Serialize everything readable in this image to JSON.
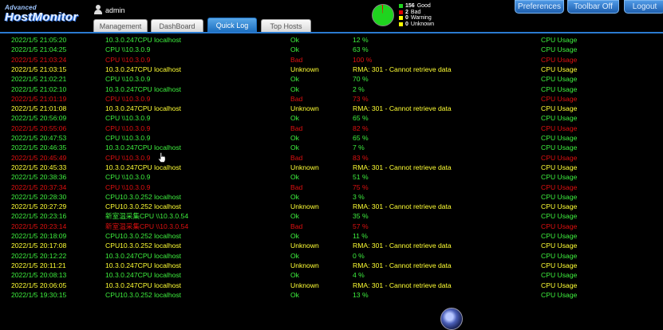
{
  "brand": {
    "line1": "Advanced",
    "line2": "HostMonitor"
  },
  "user": {
    "name": "admin"
  },
  "tabs": [
    {
      "label": "Management",
      "active": false
    },
    {
      "label": "DashBoard",
      "active": false
    },
    {
      "label": "Quick Log",
      "active": true
    },
    {
      "label": "Top Hosts",
      "active": false
    }
  ],
  "status_summary": {
    "colors": {
      "good": "#1fd41f",
      "bad": "#e00000",
      "warning": "#ffff00",
      "unknown": "#ffff00"
    },
    "legend": [
      {
        "count": "156",
        "label": "Good",
        "color": "#1fd41f"
      },
      {
        "count": "2",
        "label": "Bad",
        "color": "#e00000"
      },
      {
        "count": "0",
        "label": "Warning",
        "color": "#ffff00"
      },
      {
        "count": "0",
        "label": "Unknown",
        "color": "#ffff00"
      }
    ]
  },
  "toolbar": {
    "preferences": "Preferences",
    "toolbar_off": "Toolbar Off",
    "logout": "Logout"
  },
  "status_colors": {
    "Ok": "#3ef03e",
    "Bad": "#e01010",
    "Unknown": "#ffff33"
  },
  "log": [
    {
      "time": "2022/1/5 21:05:20",
      "host": "10.3.0.247CPU localhost",
      "status": "Ok",
      "reply": "12 %",
      "test": "CPU Usage"
    },
    {
      "time": "2022/1/5 21:04:25",
      "host": "CPU \\\\10.3.0.9",
      "status": "Ok",
      "reply": "63 %",
      "test": "CPU Usage"
    },
    {
      "time": "2022/1/5 21:03:24",
      "host": "CPU \\\\10.3.0.9",
      "status": "Bad",
      "reply": "100 %",
      "test": "CPU Usage"
    },
    {
      "time": "2022/1/5 21:03:15",
      "host": "10.3.0.247CPU localhost",
      "status": "Unknown",
      "reply": "RMA: 301 - Cannot retrieve data",
      "test": "CPU Usage"
    },
    {
      "time": "2022/1/5 21:02:21",
      "host": "CPU \\\\10.3.0.9",
      "status": "Ok",
      "reply": "70 %",
      "test": "CPU Usage"
    },
    {
      "time": "2022/1/5 21:02:10",
      "host": "10.3.0.247CPU localhost",
      "status": "Ok",
      "reply": "2 %",
      "test": "CPU Usage"
    },
    {
      "time": "2022/1/5 21:01:19",
      "host": "CPU \\\\10.3.0.9",
      "status": "Bad",
      "reply": "73 %",
      "test": "CPU Usage"
    },
    {
      "time": "2022/1/5 21:01:08",
      "host": "10.3.0.247CPU localhost",
      "status": "Unknown",
      "reply": "RMA: 301 - Cannot retrieve data",
      "test": "CPU Usage"
    },
    {
      "time": "2022/1/5 20:56:09",
      "host": "CPU \\\\10.3.0.9",
      "status": "Ok",
      "reply": "65 %",
      "test": "CPU Usage"
    },
    {
      "time": "2022/1/5 20:55:06",
      "host": "CPU \\\\10.3.0.9",
      "status": "Bad",
      "reply": "82 %",
      "test": "CPU Usage"
    },
    {
      "time": "2022/1/5 20:47:53",
      "host": "CPU \\\\10.3.0.9",
      "status": "Ok",
      "reply": "65 %",
      "test": "CPU Usage"
    },
    {
      "time": "2022/1/5 20:46:35",
      "host": "10.3.0.247CPU localhost",
      "status": "Ok",
      "reply": "7 %",
      "test": "CPU Usage"
    },
    {
      "time": "2022/1/5 20:45:49",
      "host": "CPU \\\\10.3.0.9",
      "status": "Bad",
      "reply": "83 %",
      "test": "CPU Usage"
    },
    {
      "time": "2022/1/5 20:45:33",
      "host": "10.3.0.247CPU localhost",
      "status": "Unknown",
      "reply": "RMA: 301 - Cannot retrieve data",
      "test": "CPU Usage"
    },
    {
      "time": "2022/1/5 20:38:36",
      "host": "CPU \\\\10.3.0.9",
      "status": "Ok",
      "reply": "51 %",
      "test": "CPU Usage"
    },
    {
      "time": "2022/1/5 20:37:34",
      "host": "CPU \\\\10.3.0.9",
      "status": "Bad",
      "reply": "75 %",
      "test": "CPU Usage"
    },
    {
      "time": "2022/1/5 20:28:30",
      "host": "CPU10.3.0.252 localhost",
      "status": "Ok",
      "reply": "3 %",
      "test": "CPU Usage"
    },
    {
      "time": "2022/1/5 20:27:29",
      "host": "CPU10.3.0.252 localhost",
      "status": "Unknown",
      "reply": "RMA: 301 - Cannot retrieve data",
      "test": "CPU Usage"
    },
    {
      "time": "2022/1/5 20:23:16",
      "host": "新室温采集CPU \\\\10.3.0.54",
      "status": "Ok",
      "reply": "35 %",
      "test": "CPU Usage"
    },
    {
      "time": "2022/1/5 20:23:14",
      "host": "新室温采集CPU \\\\10.3.0.54",
      "status": "Bad",
      "reply": "57 %",
      "test": "CPU Usage"
    },
    {
      "time": "2022/1/5 20:18:09",
      "host": "CPU10.3.0.252 localhost",
      "status": "Ok",
      "reply": "11 %",
      "test": "CPU Usage"
    },
    {
      "time": "2022/1/5 20:17:08",
      "host": "CPU10.3.0.252 localhost",
      "status": "Unknown",
      "reply": "RMA: 301 - Cannot retrieve data",
      "test": "CPU Usage"
    },
    {
      "time": "2022/1/5 20:12:22",
      "host": "10.3.0.247CPU localhost",
      "status": "Ok",
      "reply": "0 %",
      "test": "CPU Usage"
    },
    {
      "time": "2022/1/5 20:11:21",
      "host": "10.3.0.247CPU localhost",
      "status": "Unknown",
      "reply": "RMA: 301 - Cannot retrieve data",
      "test": "CPU Usage"
    },
    {
      "time": "2022/1/5 20:08:13",
      "host": "10.3.0.247CPU localhost",
      "status": "Ok",
      "reply": "4 %",
      "test": "CPU Usage"
    },
    {
      "time": "2022/1/5 20:06:05",
      "host": "10.3.0.247CPU localhost",
      "status": "Unknown",
      "reply": "RMA: 301 - Cannot retrieve data",
      "test": "CPU Usage"
    },
    {
      "time": "2022/1/5 19:30:15",
      "host": "CPU10.3.0.252 localhost",
      "status": "Ok",
      "reply": "13 %",
      "test": "CPU Usage"
    }
  ]
}
